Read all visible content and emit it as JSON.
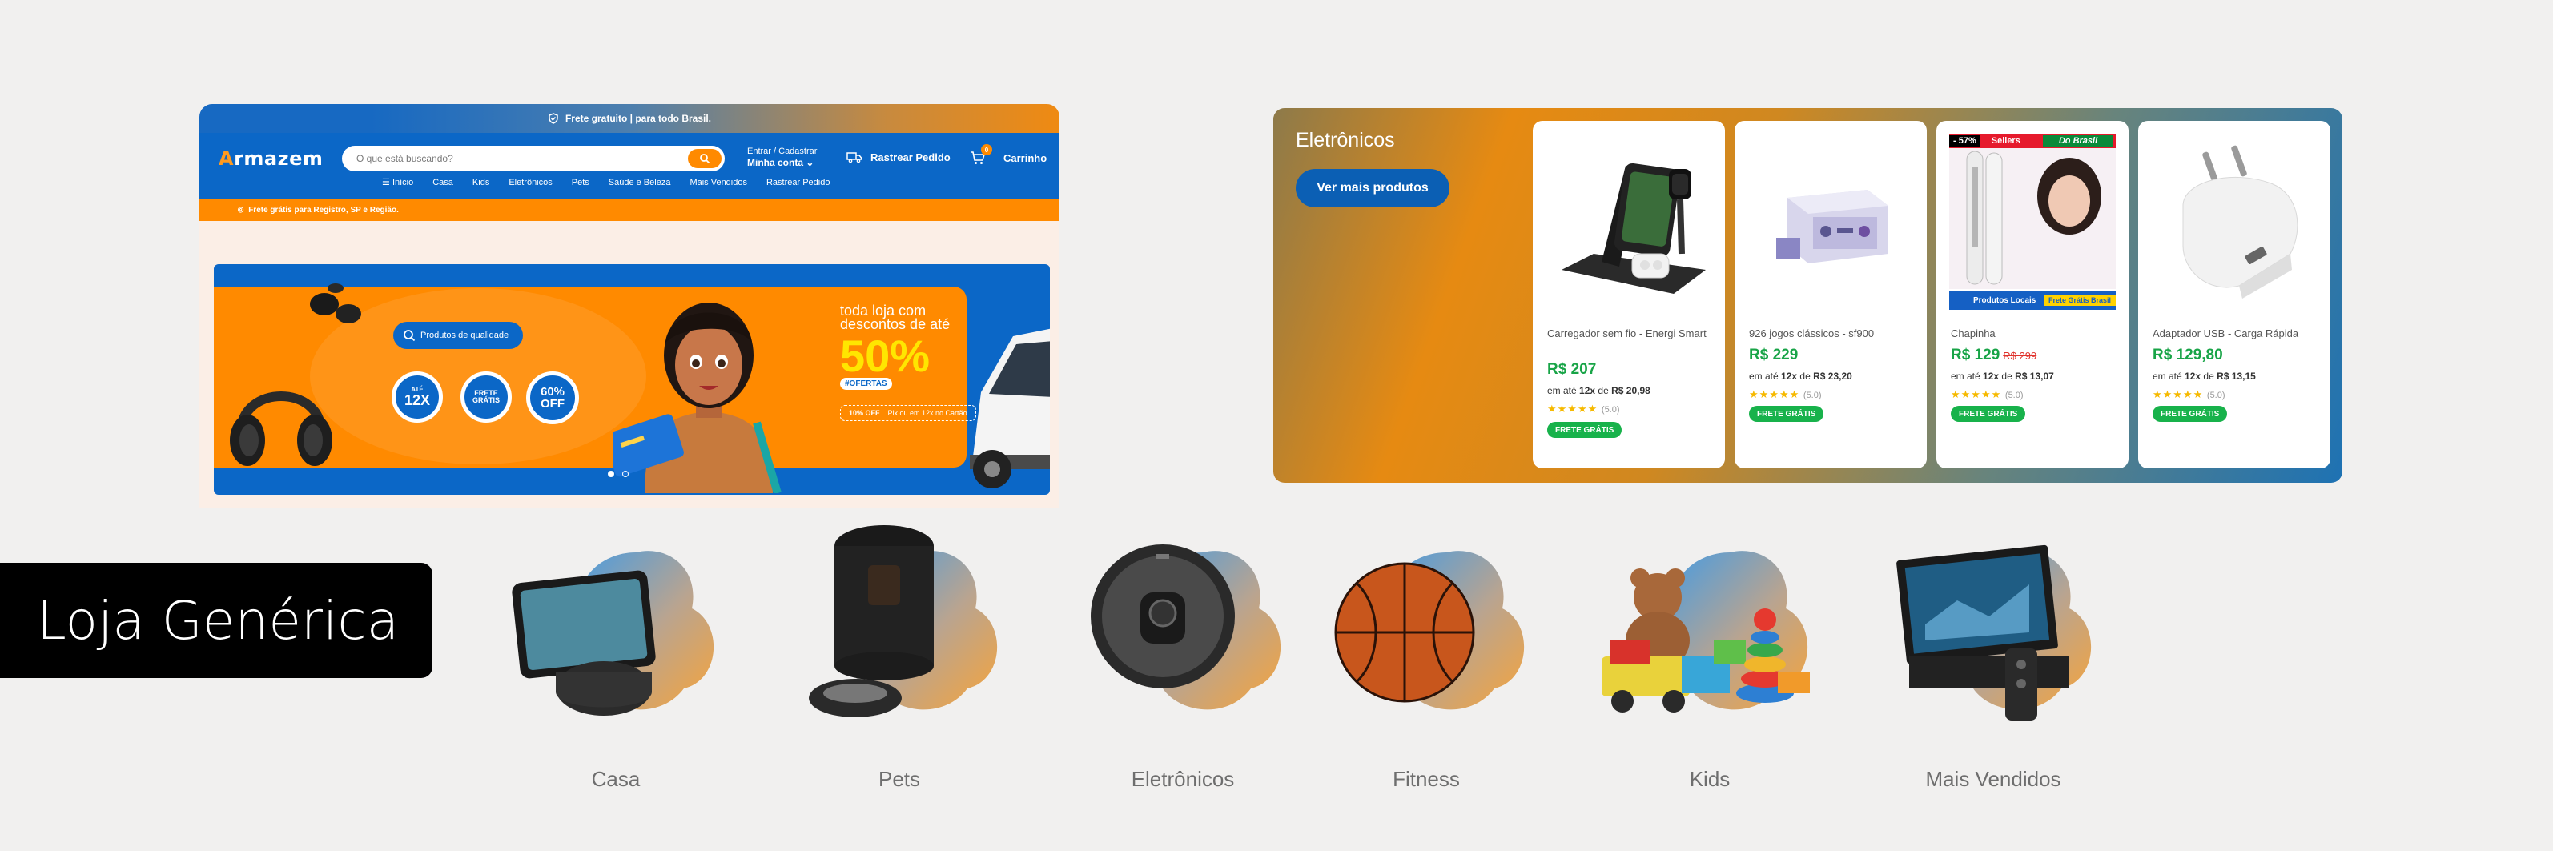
{
  "store": {
    "topbar_text": "Frete gratuito | para todo Brasil.",
    "logo_letter": "A",
    "logo_rest": "rmazem",
    "search_placeholder": "O que está buscando?",
    "account_line1": "Entrar / Cadastrar",
    "account_line2": "Minha conta",
    "track_label": "Rastrear Pedido",
    "cart_count": "0",
    "cart_label": "Carrinho",
    "nav": [
      "Início",
      "Casa",
      "Kids",
      "Eletrônicos",
      "Pets",
      "Saúde e Beleza",
      "Mais Vendidos",
      "Rastrear Pedido"
    ],
    "shipping_bar": "Frete grátis para Registro, SP e Região.",
    "hero": {
      "quality_chip": "Produtos de qualidade",
      "badge1_top": "ATÉ",
      "badge1_main": "12X",
      "badge2_top": "FRETE",
      "badge2_main": "GRÁTIS",
      "badge3_main": "60% OFF",
      "promo_line1": "toda loja com",
      "promo_line2": "descontos de até",
      "promo_big": "50%",
      "promo_tag": "#OFERTAS",
      "pix_left": "10% OFF",
      "pix_right": "Pix ou em 12x no Cartão"
    }
  },
  "panel": {
    "title": "Eletrônicos",
    "button": "Ver mais produtos",
    "products": [
      {
        "name": "Carregador sem fio - Energi Smart",
        "price": "R$ 207",
        "old_price": "",
        "inst_prefix": "em até",
        "inst_n": "12x",
        "inst_de": "de",
        "inst_val": "R$ 20,98",
        "stars": "★★★★★",
        "rating": "(5.0)",
        "ship": "FRETE GRÁTIS"
      },
      {
        "name": "926 jogos clássicos - sf900",
        "price": "R$ 229",
        "old_price": "",
        "inst_prefix": "em até",
        "inst_n": "12x",
        "inst_de": "de",
        "inst_val": "R$ 23,20",
        "stars": "★★★★★",
        "rating": "(5.0)",
        "ship": "FRETE GRÁTIS"
      },
      {
        "name": "Chapinha",
        "price": "R$ 129",
        "old_price": "R$ 299",
        "inst_prefix": "em até",
        "inst_n": "12x",
        "inst_de": "de",
        "inst_val": "R$ 13,07",
        "stars": "★★★★★",
        "rating": "(5.0)",
        "ship": "FRETE GRÁTIS",
        "badge_off": "- 57%",
        "badge_sellers": "Sellers",
        "badge_brasil": "Do Brasil",
        "badge_local": "Produtos Locais",
        "badge_frete": "Frete Grátis Brasil"
      },
      {
        "name": "Adaptador USB - Carga Rápida",
        "price": "R$ 129,80",
        "old_price": "",
        "inst_prefix": "em até",
        "inst_n": "12x",
        "inst_de": "de",
        "inst_val": "R$ 13,15",
        "stars": "★★★★★",
        "rating": "(5.0)",
        "ship": "FRETE GRÁTIS"
      }
    ]
  },
  "brand_label": "Loja Genérica",
  "categories": [
    "Casa",
    "Pets",
    "Eletrônicos",
    "Fitness",
    "Kids",
    "Mais Vendidos"
  ],
  "colors": {
    "blue": "#0b67c7",
    "orange": "#ff8a00",
    "green": "#18a447",
    "blob_blue": "#4aa3e6",
    "blob_orange": "#f6a23a"
  }
}
